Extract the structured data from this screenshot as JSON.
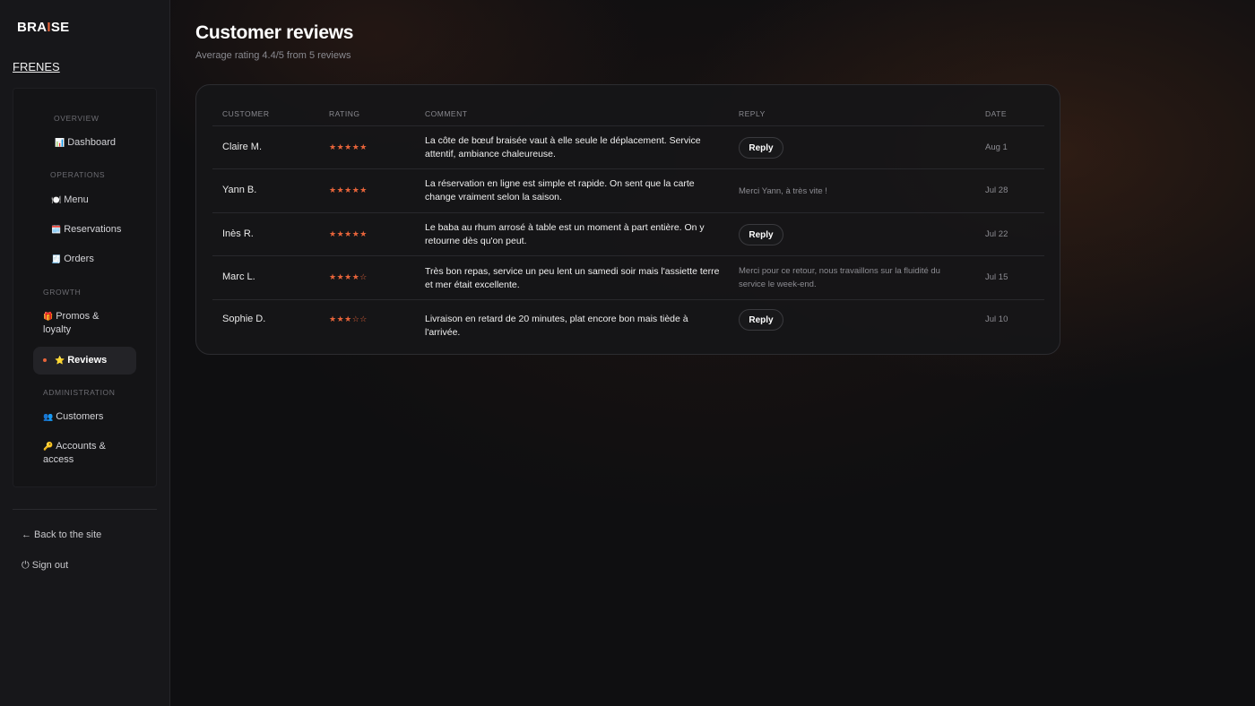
{
  "brand": {
    "logo_prefix": "BRA",
    "logo_accent": "I",
    "logo_suffix": "SE",
    "accent_color": "#e8643a"
  },
  "sidebar": {
    "restaurant": "FRENES",
    "sections": {
      "overview": "OVERVIEW",
      "operations": "OPERATIONS",
      "growth": "GROWTH",
      "administration": "ADMINISTRATION"
    },
    "items": {
      "dashboard": {
        "icon": "📊",
        "label": "Dashboard"
      },
      "menu": {
        "icon": "🍽️",
        "label": "Menu"
      },
      "reservations": {
        "icon": "🗓️",
        "label": "Reservations"
      },
      "orders": {
        "icon": "🧾",
        "label": "Orders"
      },
      "promos": {
        "icon": "🎁",
        "label": "Promos &",
        "label2": "loyalty"
      },
      "reviews": {
        "icon": "⭐",
        "label": "Reviews"
      },
      "customers": {
        "icon": "👥",
        "label": "Customers"
      },
      "accounts": {
        "icon": "🔑",
        "label": "Accounts &",
        "label2": "access"
      }
    },
    "footer": {
      "back": "← Back to the site",
      "signout": "⏻ Sign out"
    }
  },
  "page": {
    "title": "Customer reviews",
    "subtitle": "Average rating 4.4/5 from 5 reviews"
  },
  "table": {
    "headers": {
      "customer": "CUSTOMER",
      "rating": "RATING",
      "comment": "COMMENT",
      "reply": "REPLY",
      "date": "DATE"
    },
    "reply_button_label": "Reply",
    "rows": [
      {
        "customer": "Claire M.",
        "stars": "★★★★★",
        "rating": 5,
        "comment": "La côte de bœuf braisée vaut à elle seule le déplacement. Service attentif, ambiance chaleureuse.",
        "reply": "",
        "date": "Aug 1"
      },
      {
        "customer": "Yann B.",
        "stars": "★★★★★",
        "rating": 5,
        "comment": "La réservation en ligne est simple et rapide. On sent que la carte change vraiment selon la saison.",
        "reply": "Merci Yann, à très vite !",
        "date": "Jul 28"
      },
      {
        "customer": "Inès R.",
        "stars": "★★★★★",
        "rating": 5,
        "comment": "Le baba au rhum arrosé à table est un moment à part entière. On y retourne dès qu'on peut.",
        "reply": "",
        "date": "Jul 22"
      },
      {
        "customer": "Marc L.",
        "stars": "★★★★☆",
        "rating": 4,
        "comment": "Très bon repas, service un peu lent un samedi soir mais l'assiette terre et mer était excellente.",
        "reply": "Merci pour ce retour, nous travaillons sur la fluidité du service le week-end.",
        "date": "Jul 15"
      },
      {
        "customer": "Sophie D.",
        "stars": "★★★☆☆",
        "rating": 3,
        "comment": "Livraison en retard de 20 minutes, plat encore bon mais tiède à l'arrivée.",
        "reply": "",
        "date": "Jul 10"
      }
    ]
  }
}
